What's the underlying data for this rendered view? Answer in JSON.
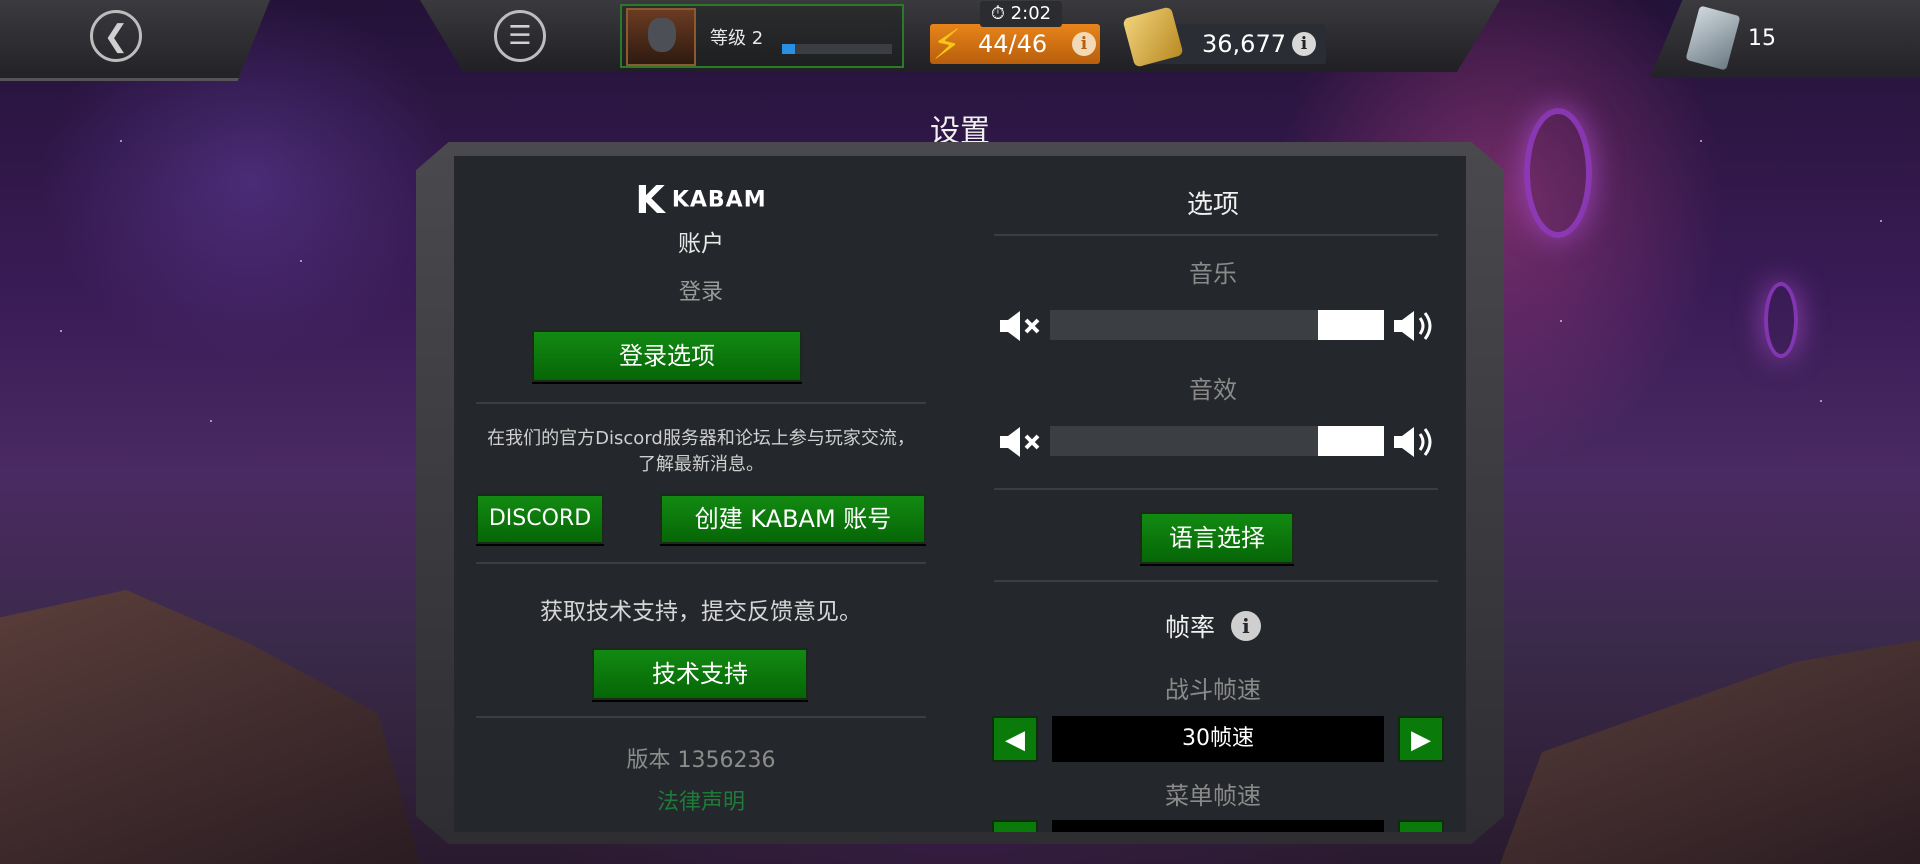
{
  "topbar": {
    "level_label": "等级 2",
    "level_progress": 0.12,
    "energy_timer": "2:02",
    "energy_value": "44/46",
    "gold_value": "36,677",
    "crystal_count": "15"
  },
  "page_title": "设置",
  "account": {
    "brand": "KABAM",
    "heading": "账户",
    "login_status": "登录",
    "login_options_button": "登录选项",
    "community_text": "在我们的官方Discord服务器和论坛上参与玩家交流，了解最新消息。",
    "discord_button": "DISCORD",
    "create_account_button": "创建 KABAM 账号",
    "support_text": "获取技术支持，提交反馈意见。",
    "support_button": "技术支持",
    "version": "版本 1356236",
    "legal_link": "法律声明"
  },
  "options": {
    "heading": "选项",
    "music_label": "音乐",
    "music_level": 1.0,
    "sfx_label": "音效",
    "sfx_level": 1.0,
    "language_button": "语言选择",
    "framerate_heading": "帧率",
    "battle_fps_label": "战斗帧速",
    "battle_fps_value": "30帧速",
    "menu_fps_label": "菜单帧速"
  },
  "icons": {
    "back": "back-arrow-icon",
    "menu": "menu-icon",
    "energy": "lightning-bolt-icon",
    "gold": "gold-icon",
    "crystal": "crystal-icon",
    "info": "info-icon",
    "timer": "stopwatch-icon",
    "mute": "speaker-mute-icon",
    "volume": "speaker-volume-icon"
  },
  "colors": {
    "button_green": "#0a7a0a",
    "energy_orange": "#e8841a",
    "level_blue": "#2a8fe0",
    "legal_link_green": "#1f7a3a"
  }
}
